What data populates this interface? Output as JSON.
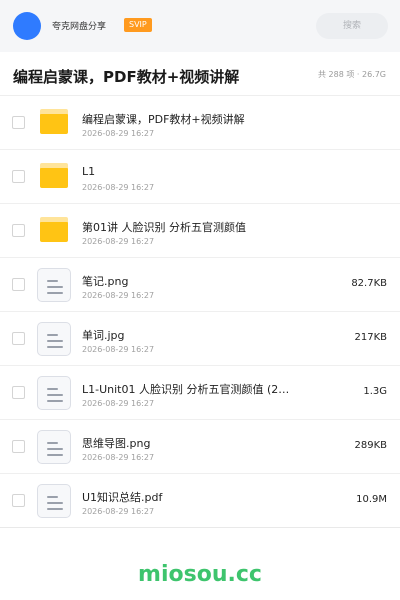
{
  "header": {
    "user_name": "夸克网盘分享",
    "badge": "SVIP",
    "search_placeholder": "搜索"
  },
  "title_bar": {
    "title": "编程启蒙课，PDF教材+视频讲解",
    "summary": "共 288 项 · 26.7G"
  },
  "files": [
    {
      "type": "folder",
      "icon": "folder-icon",
      "name": "编程启蒙课，PDF教材+视频讲解",
      "date": "2026-08-29 16:27",
      "size": ""
    },
    {
      "type": "folder",
      "icon": "folder-icon",
      "name": "L1",
      "date": "2026-08-29 16:27",
      "size": ""
    },
    {
      "type": "folder",
      "icon": "folder-icon",
      "name": "第01讲 人脸识别 分析五官测颜值",
      "date": "2026-08-29 16:27",
      "size": ""
    },
    {
      "type": "file",
      "icon": "document-icon",
      "name": "笔记.png",
      "date": "2026-08-29 16:27",
      "size": "82.7KB"
    },
    {
      "type": "file",
      "icon": "document-icon",
      "name": "单词.jpg",
      "date": "2026-08-29 16:27",
      "size": "217KB"
    },
    {
      "type": "file",
      "icon": "document-icon",
      "name": "L1-Unit01 人脸识别 分析五官测颜值 (2…",
      "date": "2026-08-29 16:27",
      "size": "1.3G"
    },
    {
      "type": "file",
      "icon": "document-icon",
      "name": "思维导图.png",
      "date": "2026-08-29 16:27",
      "size": "289KB"
    },
    {
      "type": "file",
      "icon": "document-icon",
      "name": "U1知识总结.pdf",
      "date": "2026-08-29 16:27",
      "size": "10.9M"
    }
  ],
  "watermark": "miosou.cc",
  "colors": {
    "avatar": "#2f7bff",
    "svip_badge": "#ff9a1f",
    "folder": "#ffc414",
    "watermark": "#3ec46d"
  }
}
